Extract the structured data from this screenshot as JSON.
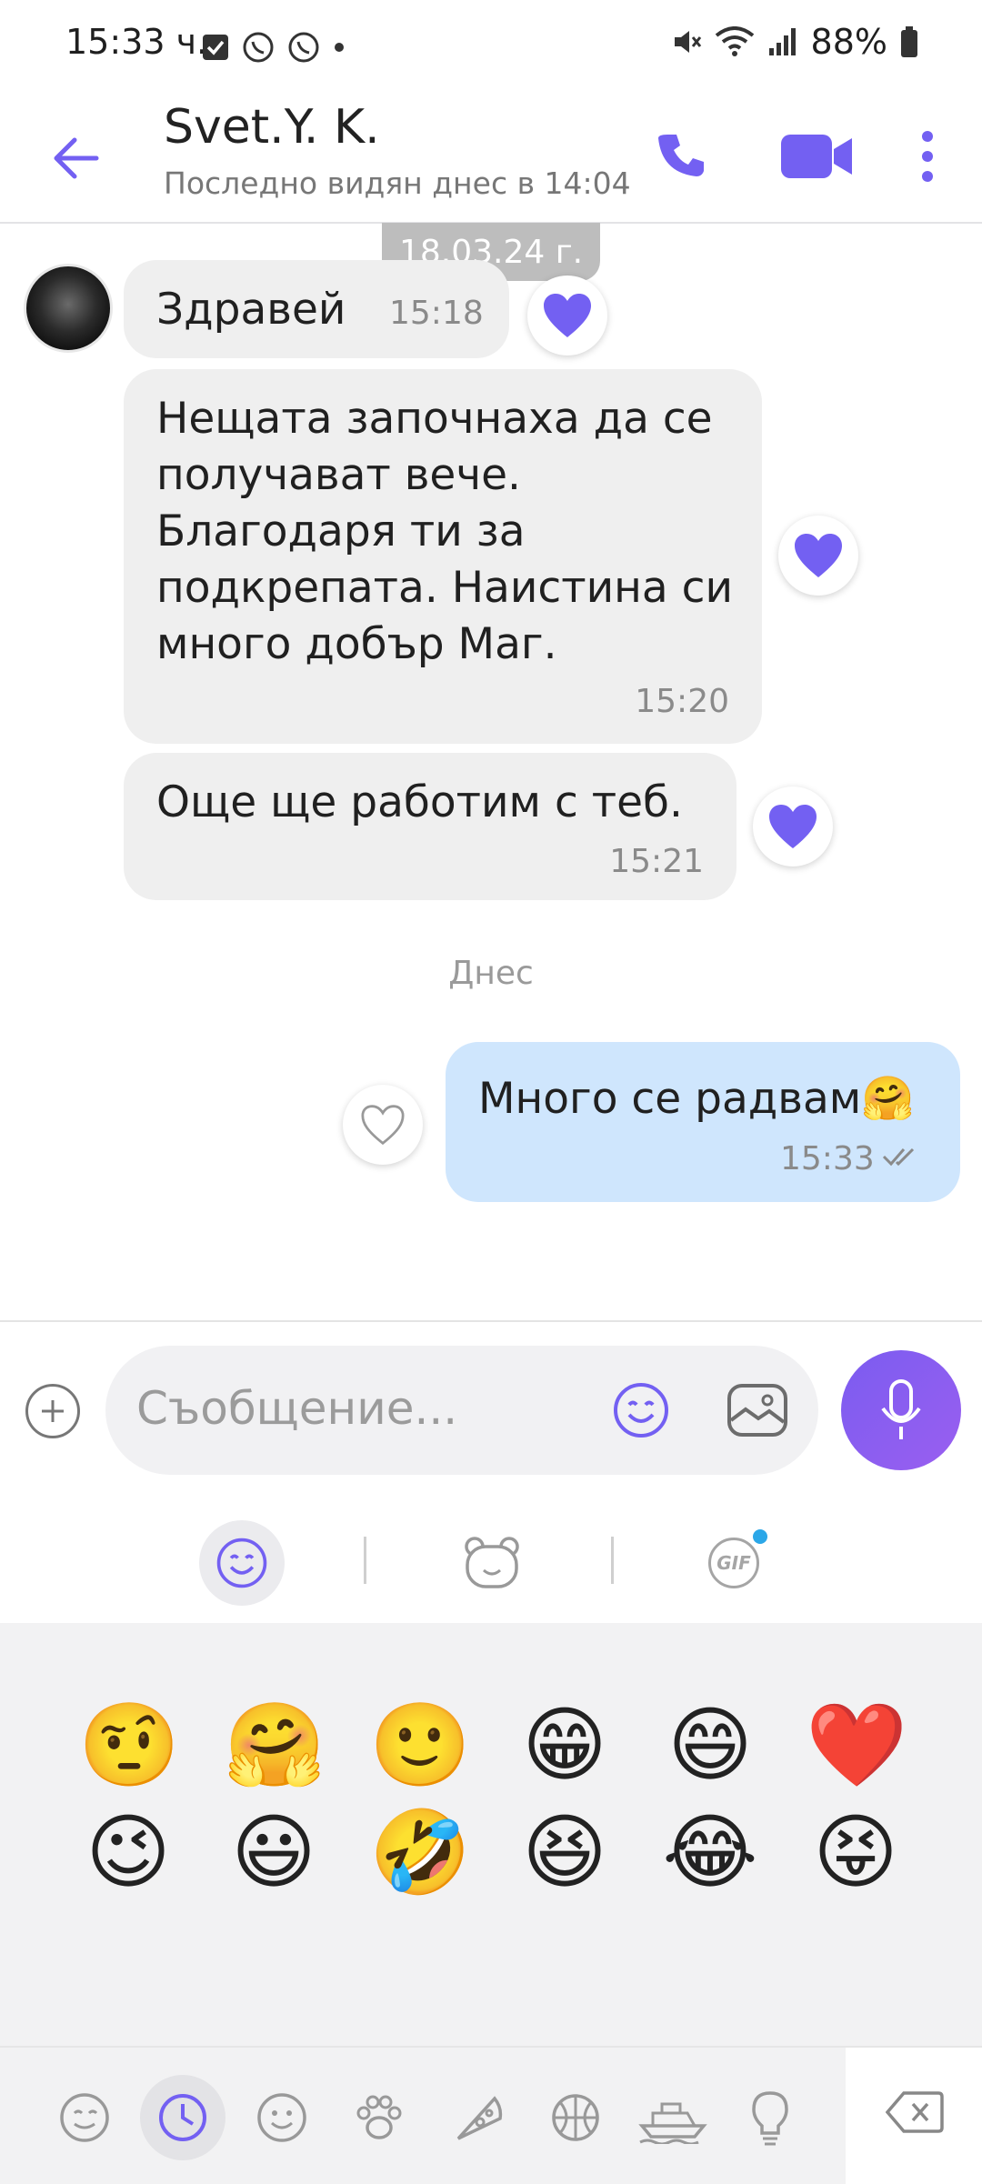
{
  "status_bar": {
    "time": "15:33 ч.",
    "battery": "88%"
  },
  "header": {
    "contact_name": "Svet.Y. K.",
    "last_seen": "Последно видян днес в 14:04"
  },
  "chat": {
    "date_label": "18.03.24 г.",
    "day_separator": "Днес",
    "messages": [
      {
        "direction": "incoming",
        "text": "Здравей",
        "time": "15:18",
        "liked": true
      },
      {
        "direction": "incoming",
        "text": "Нещата започнаха да се получават вече. Благодаря ти за подкрепата. Наистина си много добър Маг.",
        "time": "15:20",
        "liked": true
      },
      {
        "direction": "incoming",
        "text": "Още ще работим с теб.",
        "time": "15:21",
        "liked": true
      },
      {
        "direction": "outgoing",
        "text": "Много се радвам🤗",
        "time": "15:33",
        "liked": false,
        "status": "read"
      }
    ]
  },
  "composer": {
    "placeholder": "Съобщение..."
  },
  "emoji_tabs": {
    "gif_label": "GIF"
  },
  "emoji_grid": {
    "row1": [
      "🤨",
      "🤗",
      "🙂",
      "😁",
      "😄",
      "❤️"
    ],
    "row2": [
      "😉",
      "😃",
      "🤣",
      "😆",
      "😂",
      "😝"
    ]
  },
  "colors": {
    "accent": "#7360f2",
    "incoming_bubble": "#efefef",
    "outgoing_bubble": "#cfe6fd"
  }
}
